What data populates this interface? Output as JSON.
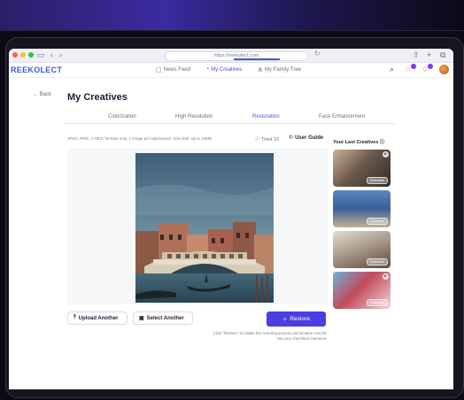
{
  "browser": {
    "url": "https://reekolect.com"
  },
  "app": {
    "logo": "REEKOLECT",
    "nav": [
      {
        "label": "News Feed",
        "active": false
      },
      {
        "label": "My Creatives",
        "active": true
      },
      {
        "label": "My Family Tree",
        "active": false
      }
    ]
  },
  "page": {
    "back_label": "Back",
    "title": "My Creatives",
    "tabs": [
      {
        "label": "Colorization",
        "active": false
      },
      {
        "label": "High Resolution",
        "active": false
      },
      {
        "label": "Restoration",
        "active": true
      },
      {
        "label": "Face Enhancement",
        "active": false
      }
    ],
    "hint": "JPEG, PNG, 1-HEIC formats only; 1 image per submission; Size limit: up to 10MB",
    "tried": "Tried 10",
    "user_guide": "User Guide"
  },
  "actions": {
    "upload_another": "Upload Another",
    "select_another": "Select Another",
    "restore": "Restore",
    "note": "Click \"Restore\" to initiate the restoring process and breathe new life into your cherished memories"
  },
  "sidebar": {
    "title": "Your Last Creatives",
    "items": [
      {
        "label": "Animated"
      },
      {
        "label": "Colorized"
      },
      {
        "label": "Animated"
      },
      {
        "label": "Colorized"
      }
    ]
  },
  "colors": {
    "accent": "#4a3fe0",
    "brand": "#3d5bd9"
  },
  "icons": [
    "back-arrow-icon",
    "upload-icon",
    "gallery-icon",
    "sparkle-icon",
    "user-guide-icon",
    "info-icon",
    "search-icon",
    "bell-icon",
    "chat-icon"
  ]
}
